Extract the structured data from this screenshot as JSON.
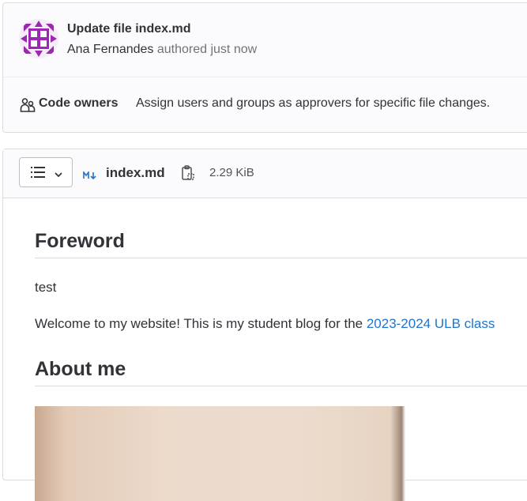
{
  "commit": {
    "title": "Update file index.md",
    "author": "Ana Fernandes",
    "authored_text": "authored just now"
  },
  "code_owners": {
    "label": "Code owners",
    "description": "Assign users and groups as approvers for specific file changes."
  },
  "file": {
    "name": "index.md",
    "size": "2.29 KiB",
    "icons": {
      "toc": "list-icon",
      "toc_caret": "chevron-down-icon",
      "type": "markdown-icon",
      "copy": "copy-path-icon"
    }
  },
  "content": {
    "heading_foreword": "Foreword",
    "para_test": "test",
    "para_welcome_text": "Welcome to my website! This is my student blog for the ",
    "para_welcome_link": "2023-2024 ULB class",
    "heading_about": "About me"
  },
  "colors": {
    "link": "#1f75cb",
    "avatar": "#9c27b0",
    "border": "#dcdcde"
  }
}
